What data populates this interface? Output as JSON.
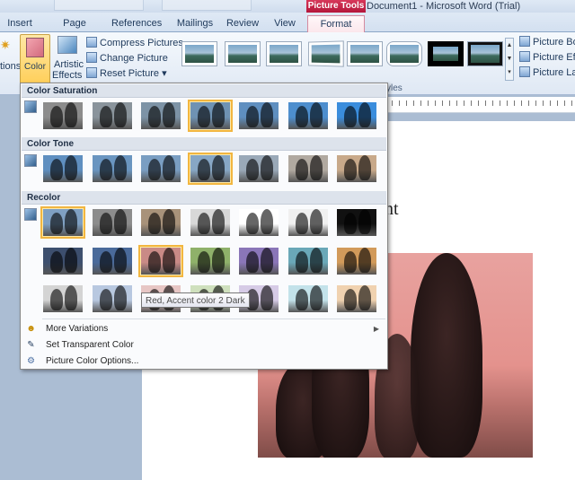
{
  "titlebar": {
    "context_tab": "Picture Tools",
    "doc_title": "Document1  -  Microsoft Word (Trial)"
  },
  "tabs": [
    {
      "label": "Insert"
    },
    {
      "label": "Page Layout"
    },
    {
      "label": "References"
    },
    {
      "label": "Mailings"
    },
    {
      "label": "Review"
    },
    {
      "label": "View"
    },
    {
      "label": "Format"
    }
  ],
  "ribbon": {
    "left_cut_label": "tions",
    "color_label": "Color",
    "artistic_effects_line1": "Artistic",
    "artistic_effects_line2": "Effects",
    "compress_pictures": "Compress Pictures",
    "change_picture": "Change Picture",
    "reset_picture": "Reset Picture",
    "picture_border": "Picture Bord",
    "picture_effects": "Picture Effe",
    "picture_layout": "Picture Layo",
    "styles_group": "yles"
  },
  "dropdown": {
    "sections": [
      {
        "title": "Color Saturation",
        "selected_index": 3,
        "colors": [
          "#8c8c8c",
          "#8a949c",
          "#7d93a6",
          "#6f92b3",
          "#5f8fc0",
          "#4d8ece",
          "#3a8ddd"
        ]
      },
      {
        "title": "Color Tone",
        "selected_index": 3,
        "colors": [
          "#5f8fc0",
          "#6a95c0",
          "#7a9ec2",
          "#87a7c5",
          "#9aa9b8",
          "#b1a9a0",
          "#c8a98a"
        ]
      },
      {
        "title": "Recolor"
      }
    ],
    "recolor_rows": [
      {
        "colors": [
          "#7fa0c3",
          "#8c8c8c",
          "#a8927a",
          "#d8d8d8",
          "#ffffff",
          "#f0f0f0",
          "#111111"
        ]
      },
      {
        "colors": [
          "#3d4f6e",
          "#4a6a9a",
          "#c98a86",
          "#8fb16a",
          "#8a76b8",
          "#6aa8b8",
          "#d29a5a"
        ]
      },
      {
        "colors": [
          "#d4d4d4",
          "#b8c8e0",
          "#e7c6c4",
          "#cfe0bd",
          "#d6cbe6",
          "#c3e2ea",
          "#f0d2b0"
        ]
      }
    ],
    "more_variations": "More Variations",
    "set_transparent": "Set Transparent Color",
    "picture_color_options": "Picture Color Options...",
    "tooltip": "Red, Accent color 2 Dark"
  },
  "document": {
    "partial_text": "nt"
  },
  "colors": {
    "accent_selected": "#f2b640",
    "context_tab": "#c4234a"
  }
}
